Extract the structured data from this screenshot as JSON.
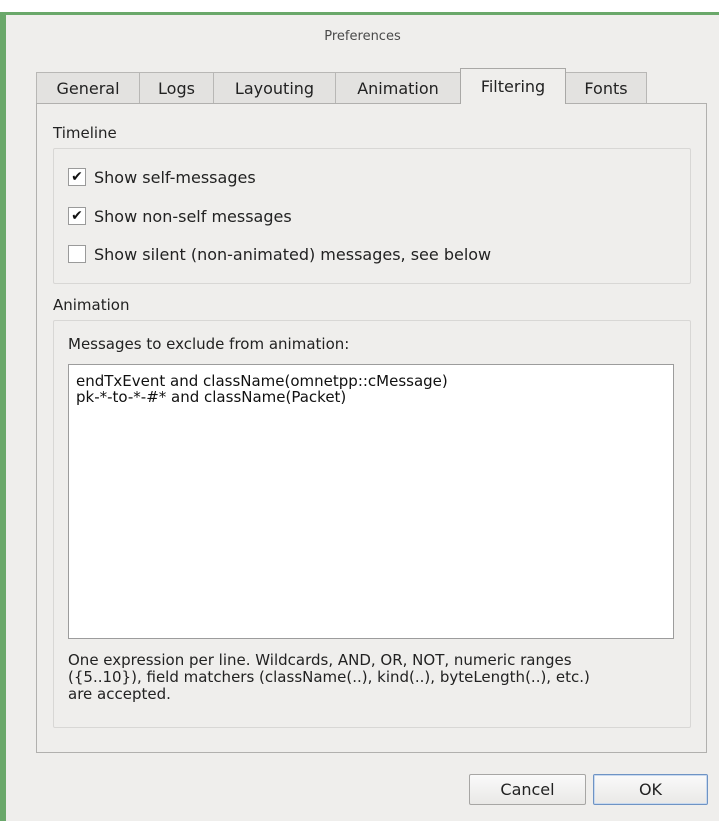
{
  "window": {
    "title": "Preferences"
  },
  "tabs": [
    {
      "label": "General",
      "active": false
    },
    {
      "label": "Logs",
      "active": false
    },
    {
      "label": "Layouting",
      "active": false
    },
    {
      "label": "Animation",
      "active": false
    },
    {
      "label": "Filtering",
      "active": true
    },
    {
      "label": "Fonts",
      "active": false
    }
  ],
  "timeline": {
    "title": "Timeline",
    "options": [
      {
        "label": "Show self-messages",
        "checked": true
      },
      {
        "label": "Show non-self messages",
        "checked": true
      },
      {
        "label": "Show silent (non-animated) messages, see below",
        "checked": false
      }
    ]
  },
  "animation": {
    "title": "Animation",
    "exclude_label": "Messages to exclude from animation:",
    "exclude_lines": [
      "endTxEvent and className(omnetpp::cMessage)",
      "pk-*-to-*-#* and className(Packet)"
    ],
    "hint_lines": [
      "One expression per line. Wildcards, AND, OR, NOT, numeric ranges",
      "({5..10}), field matchers (className(..), kind(..), byteLength(..), etc.)",
      "are accepted."
    ]
  },
  "buttons": {
    "cancel": "Cancel",
    "ok": "OK"
  },
  "check_mark": "✔"
}
